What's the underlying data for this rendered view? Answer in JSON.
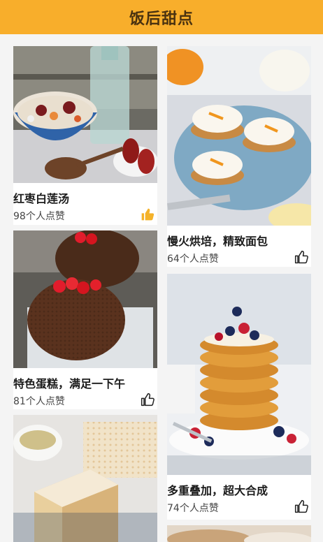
{
  "header": {
    "title": "饭后甜点"
  },
  "cards": [
    {
      "title": "红枣白莲汤",
      "likes": "98个人点赞",
      "liked": true,
      "image": "soup-photo"
    },
    {
      "title": "慢火烘培，精致面包",
      "likes": "64个人点赞",
      "liked": false,
      "image": "pumpkin-cake-photo"
    },
    {
      "title": "特色蛋糕，满足一下午",
      "likes": "81个人点赞",
      "liked": false,
      "image": "chocolate-cake-photo"
    },
    {
      "title": "多重叠加，超大合成",
      "likes": "74个人点赞",
      "liked": false,
      "image": "pancake-stack-photo"
    },
    {
      "title": "",
      "likes": "",
      "liked": false,
      "image": "napoleon-cake-photo"
    },
    {
      "title": "",
      "likes": "",
      "liked": false,
      "image": "dessert-photo"
    }
  ],
  "colors": {
    "accent": "#f8ae2b",
    "liked": "#f4b22a",
    "unliked": "#222222"
  }
}
